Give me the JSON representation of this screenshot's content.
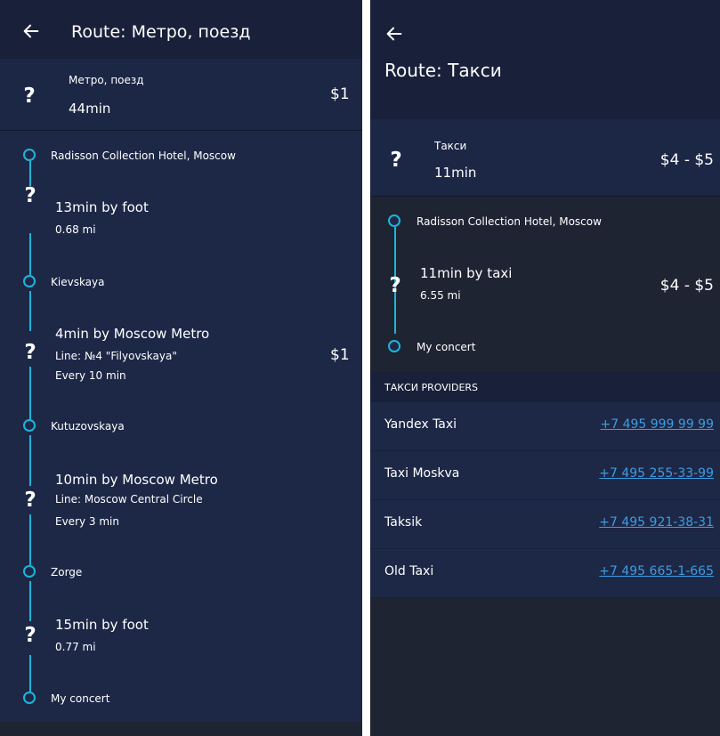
{
  "left": {
    "title": "Route: Метро, поезд",
    "summary": {
      "icon": "?",
      "mode": "Метро, поезд",
      "duration": "44min",
      "price": "$1"
    },
    "steps": {
      "s1": "Radisson Collection Hotel, Moscow",
      "s2": {
        "icon": "?",
        "title": "13min by foot",
        "detail": "0.68 mi"
      },
      "s3": "Kievskaya",
      "s4": {
        "icon": "?",
        "title": "4min by Moscow Metro",
        "line": "Line: №4 \"Filyovskaya\"",
        "freq": "Every 10 min",
        "price": "$1"
      },
      "s5": "Kutuzovskaya",
      "s6": {
        "icon": "?",
        "title": "10min by Moscow Metro",
        "line": "Line: Moscow Central Circle",
        "freq": "Every 3 min"
      },
      "s7": "Zorge",
      "s8": {
        "icon": "?",
        "title": "15min by foot",
        "detail": "0.77 mi"
      },
      "s9": "My concert"
    }
  },
  "right": {
    "title": "Route: Такси",
    "summary": {
      "icon": "?",
      "mode": "Такси",
      "duration": "11min",
      "price": "$4 - $5"
    },
    "steps": {
      "s1": "Radisson Collection Hotel, Moscow",
      "s2": {
        "icon": "?",
        "title": "11min by taxi",
        "detail": "6.55 mi",
        "price": "$4 - $5"
      },
      "s3": "My concert"
    },
    "providers_header": "ТАКСИ PROVIDERS",
    "providers": [
      {
        "name": "Yandex Taxi",
        "phone": "+7 495 999 99 99"
      },
      {
        "name": "Taxi Moskva",
        "phone": "+7 495 255-33-99"
      },
      {
        "name": "Taksik",
        "phone": "+7 495 921-38-31"
      },
      {
        "name": "Old Taxi",
        "phone": "+7 495 665-1-665"
      }
    ]
  },
  "colors": {
    "background": "#1d2847",
    "header": "#19213a",
    "accent": "#1fb4d8",
    "link": "#3d9be0"
  },
  "icons": {
    "back": "arrow-left-icon",
    "mode": "question-mark-icon",
    "node": "circle-node-icon"
  }
}
